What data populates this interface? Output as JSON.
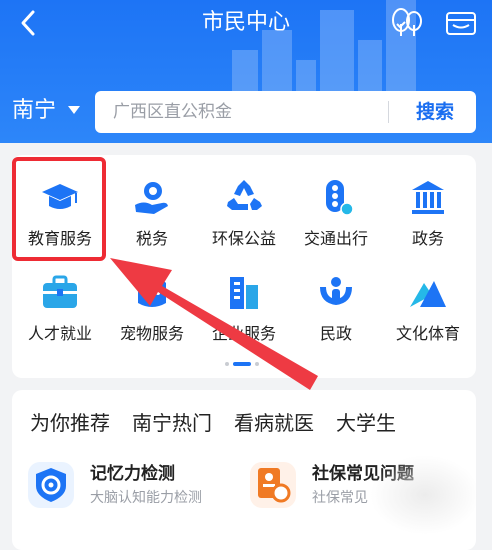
{
  "header": {
    "title": "市民中心",
    "city": "南宁",
    "search_placeholder": "广西区直公积金",
    "search_button": "搜索"
  },
  "services": [
    {
      "label": "教育服务",
      "icon": "graduation-cap-icon"
    },
    {
      "label": "税务",
      "icon": "hand-coin-icon"
    },
    {
      "label": "环保公益",
      "icon": "recycle-icon"
    },
    {
      "label": "交通出行",
      "icon": "traffic-light-icon"
    },
    {
      "label": "政务",
      "icon": "government-building-icon"
    },
    {
      "label": "人才就业",
      "icon": "briefcase-icon"
    },
    {
      "label": "宠物服务",
      "icon": "pet-icon"
    },
    {
      "label": "企业服务",
      "icon": "office-building-icon"
    },
    {
      "label": "民政",
      "icon": "people-hands-icon"
    },
    {
      "label": "文化体育",
      "icon": "mountain-icon"
    }
  ],
  "tabs": [
    "为你推荐",
    "南宁热门",
    "看病就医",
    "大学生"
  ],
  "recommendations": [
    {
      "title": "记忆力检测",
      "subtitle": "大脑认知能力检测",
      "icon": "memory-test-icon"
    },
    {
      "title": "社保常见问题",
      "subtitle": "社保常见",
      "icon": "social-security-icon"
    }
  ],
  "colors": {
    "header": "#1d74f5",
    "accent": "#1a6ef0",
    "highlight": "#ee2b34"
  }
}
